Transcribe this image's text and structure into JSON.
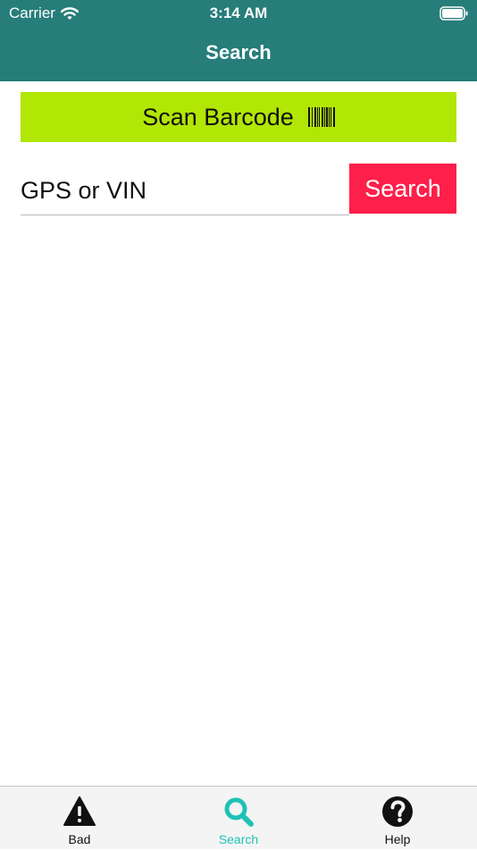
{
  "status_bar": {
    "carrier": "Carrier",
    "time": "3:14 AM"
  },
  "header": {
    "title": "Search",
    "background_color": "#267d7a"
  },
  "scan": {
    "label": "Scan Barcode",
    "icon": "barcode-icon",
    "background_color": "#b2e604"
  },
  "search": {
    "placeholder": "GPS or VIN",
    "value": "",
    "button_label": "Search",
    "button_color": "#fe1f4a"
  },
  "tabs": [
    {
      "label": "Bad",
      "icon": "warning-icon",
      "selected": false
    },
    {
      "label": "Search",
      "icon": "search-icon",
      "selected": true
    },
    {
      "label": "Help",
      "icon": "help-icon",
      "selected": false
    }
  ],
  "colors": {
    "tab_selected": "#1fc2b6",
    "tab_unselected": "#111111"
  }
}
